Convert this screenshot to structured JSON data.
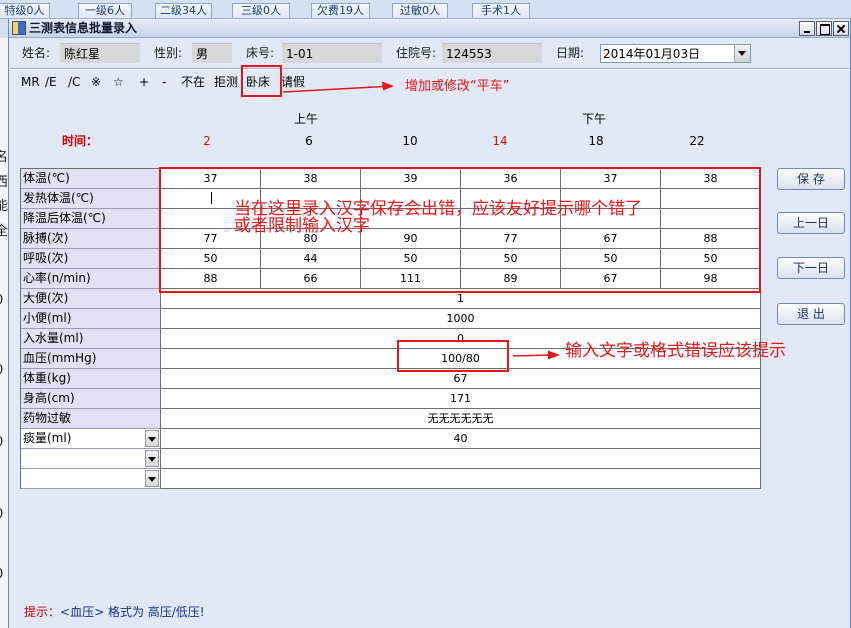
{
  "background_window": {
    "tabs": [
      "特级0人",
      "一级6人",
      "二级34人",
      "三级0人",
      "欠费19人",
      "过敏0人",
      "手术1人"
    ],
    "edge_chars": [
      "名",
      "西",
      "能",
      "全",
      "/",
      "0",
      "0",
      "0",
      "0",
      "0"
    ]
  },
  "window": {
    "title": "三测表信息批量录入",
    "icons": {
      "app": "form-icon",
      "minimize": "minimize-icon",
      "maximize": "maximize-icon",
      "close": "close-icon",
      "dropdown": "chevron-down-icon"
    }
  },
  "patient": {
    "name_label": "姓名:",
    "name": "陈红星",
    "gender_label": "性别:",
    "gender": "男",
    "bed_label": "床号:",
    "bed": "1-01",
    "admission_label": "住院号:",
    "admission_no": "124553",
    "date_label": "日期:",
    "date": "2014年01月03日"
  },
  "toolbar": {
    "items": [
      "MR",
      "/E",
      "/C",
      "※",
      "☆",
      "+",
      "-",
      "不在",
      "拒测",
      "卧床",
      "请假"
    ]
  },
  "schedule": {
    "morning_label": "上午",
    "afternoon_label": "下午",
    "time_label": "时间：",
    "times": [
      {
        "text": "2",
        "highlight": true
      },
      {
        "text": "6",
        "highlight": false
      },
      {
        "text": "10",
        "highlight": false
      },
      {
        "text": "14",
        "highlight": true
      },
      {
        "text": "18",
        "highlight": false
      },
      {
        "text": "22",
        "highlight": false
      }
    ]
  },
  "grid": {
    "timed_rows": [
      {
        "label": "体温(℃)",
        "values": [
          "37",
          "38",
          "39",
          "36",
          "37",
          "38"
        ]
      },
      {
        "label": "发热体温(℃)",
        "values": [
          "",
          "",
          "",
          "",
          "",
          ""
        ]
      },
      {
        "label": "降温后体温(℃)",
        "values": [
          "",
          "",
          "",
          "",
          "",
          ""
        ]
      },
      {
        "label": "脉搏(次)",
        "values": [
          "77",
          "80",
          "90",
          "77",
          "67",
          "88"
        ]
      },
      {
        "label": "呼吸(次)",
        "values": [
          "50",
          "44",
          "50",
          "50",
          "50",
          "50"
        ]
      },
      {
        "label": "心率(n/min)",
        "values": [
          "88",
          "66",
          "111",
          "89",
          "67",
          "98"
        ]
      }
    ],
    "single_rows": [
      {
        "label": "大便(次)",
        "value": "1"
      },
      {
        "label": "小便(ml)",
        "value": "1000"
      },
      {
        "label": "入水量(ml)",
        "value": "0"
      },
      {
        "label": "血压(mmHg)",
        "value": "100/80"
      },
      {
        "label": "体重(kg)",
        "value": "67"
      },
      {
        "label": "身高(cm)",
        "value": "171"
      },
      {
        "label": "药物过敏",
        "value": "无无无无无无"
      }
    ],
    "dropdown_rows": [
      {
        "label": "痰量(ml)",
        "value": "40"
      },
      {
        "label": "",
        "value": ""
      },
      {
        "label": "",
        "value": ""
      }
    ]
  },
  "buttons": {
    "save": "保 存",
    "prev_day": "上一日",
    "next_day": "下一日",
    "exit": "退 出"
  },
  "annotations": {
    "toolbar_note": "增加或修改“平车”",
    "grid_note_line1": "当在这里录入汉字保存会出错，应该友好提示哪个错了",
    "grid_note_line2": "或者限制输入汉字",
    "bp_note": "输入文字或格式错误应该提示"
  },
  "hint": {
    "prefix": "提示：",
    "text": "<血压> 格式为 高压/低压!"
  },
  "colors": {
    "annotation": "#e8161b",
    "highlight_time": "#e01010",
    "time_label": "#d40000",
    "hint_prefix": "#c00000",
    "hint_text": "#1a2d86",
    "label_column": "#e4e0f3",
    "dialog_background": "#e0e9f5"
  }
}
